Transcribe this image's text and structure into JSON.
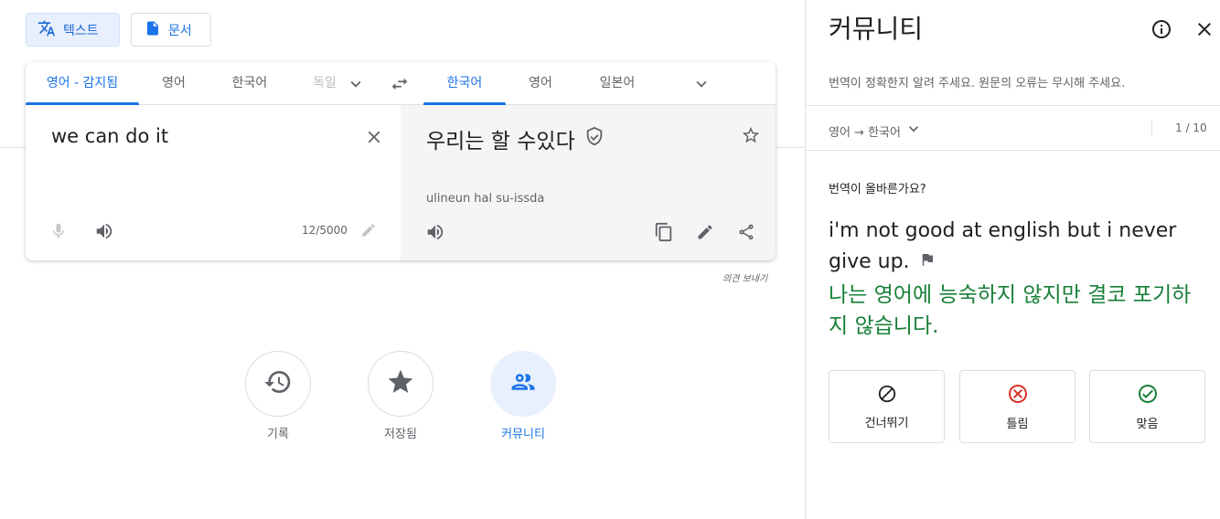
{
  "modes": {
    "text_label": "텍스트",
    "doc_label": "문서"
  },
  "source_langs": [
    {
      "label": "영어 - 감지됨",
      "active": true
    },
    {
      "label": "영어"
    },
    {
      "label": "한국어"
    },
    {
      "label": "독일"
    }
  ],
  "target_langs": [
    {
      "label": "한국어",
      "active": true
    },
    {
      "label": "영어"
    },
    {
      "label": "일본어"
    }
  ],
  "source": {
    "text": "we can do it",
    "char_count": "12/5000"
  },
  "target": {
    "text": "우리는 할 수있다",
    "romanization": "ulineun hal su-issda"
  },
  "feedback_link": "의견 보내기",
  "bottom_buttons": [
    {
      "label": "기록",
      "icon": "history-icon"
    },
    {
      "label": "저장됨",
      "icon": "star-icon"
    },
    {
      "label": "커뮤니티",
      "icon": "community-icon",
      "active": true
    }
  ],
  "panel": {
    "title": "커뮤니티",
    "description": "번역이 정확한지 알려 주세요. 원문의 오류는 무시해 주세요.",
    "lang_pair": "영어 → 한국어",
    "counter": "1 / 10",
    "question": "번역이 올바른가요?",
    "source_sentence": "i'm not good at english but i never give up.",
    "translated_sentence": "나는 영어에 능숙하지 않지만 결코 포기하지 않습니다.",
    "buttons": {
      "skip": "건너뛰기",
      "wrong": "틀림",
      "correct": "맞음"
    }
  },
  "colors": {
    "accent": "#1a73e8",
    "correct": "#188038",
    "wrong": "#d93025"
  }
}
